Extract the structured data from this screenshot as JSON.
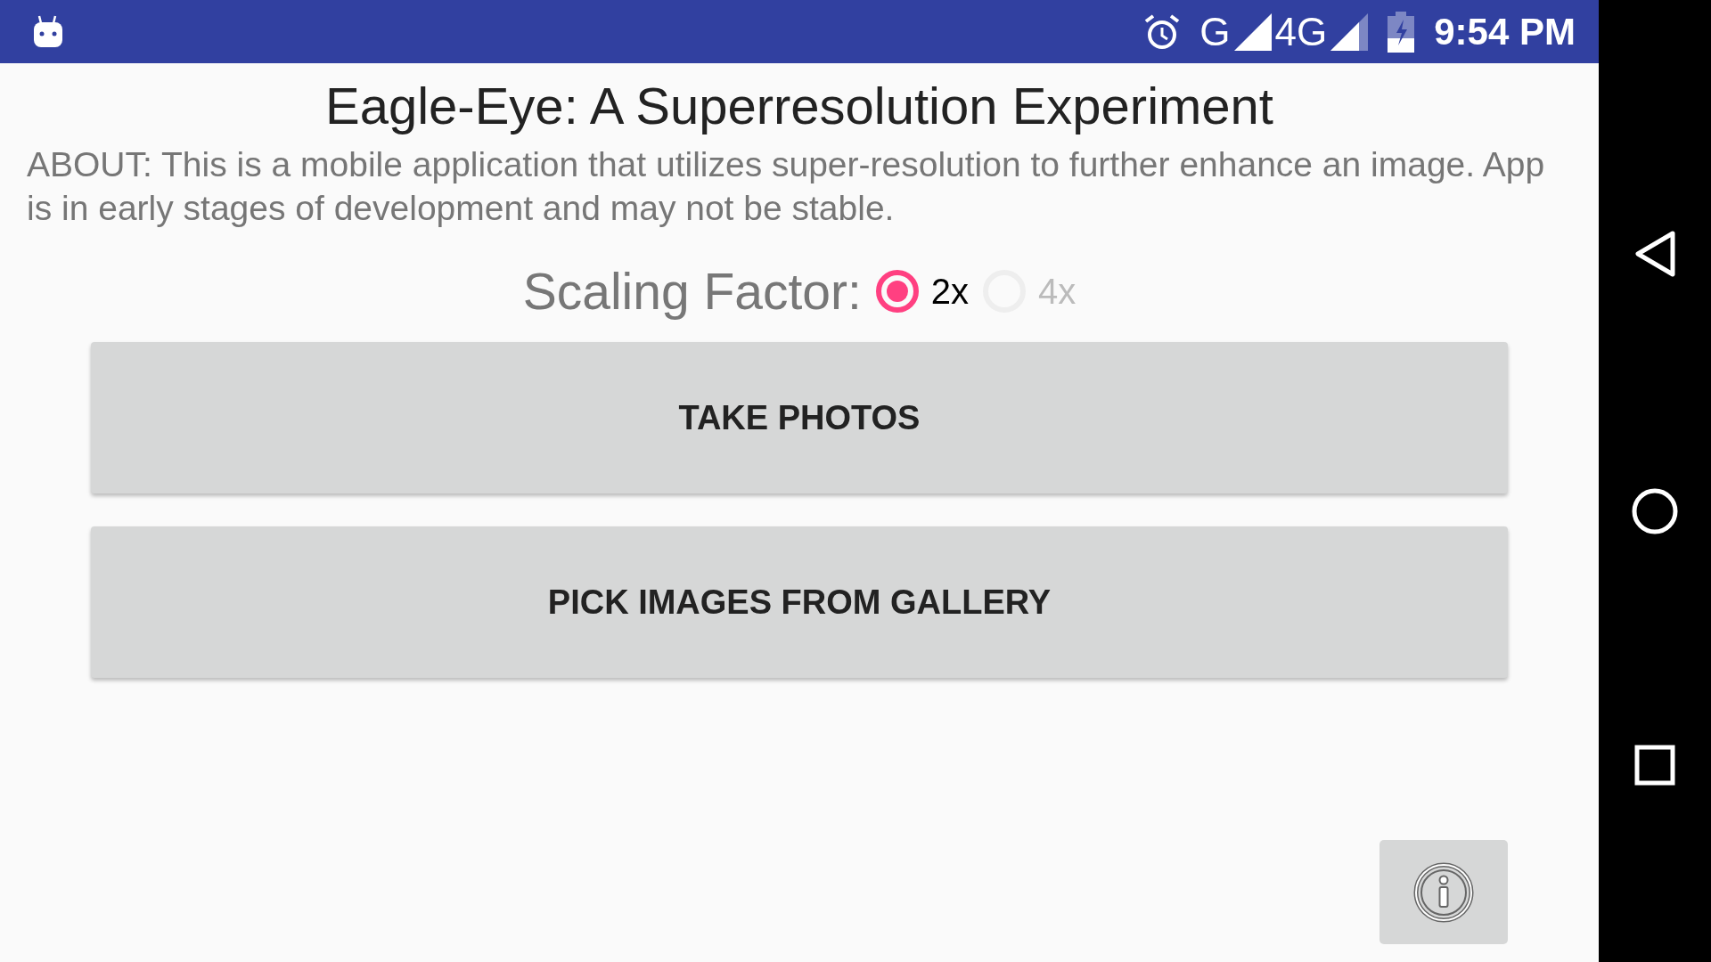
{
  "status_bar": {
    "network_1": "G",
    "network_2": "4G",
    "time": "9:54 PM"
  },
  "title": "Eagle-Eye: A Superresolution Experiment",
  "about": "ABOUT: This is a mobile application that utilizes super-resolution to further enhance an image. App is in early stages of development and may not be stable.",
  "scaling": {
    "label": "Scaling Factor:",
    "options": [
      {
        "label": "2x",
        "selected": true,
        "disabled": false
      },
      {
        "label": "4x",
        "selected": false,
        "disabled": true
      }
    ]
  },
  "buttons": [
    "TAKE PHOTOS",
    "PICK IMAGES FROM GALLERY"
  ]
}
